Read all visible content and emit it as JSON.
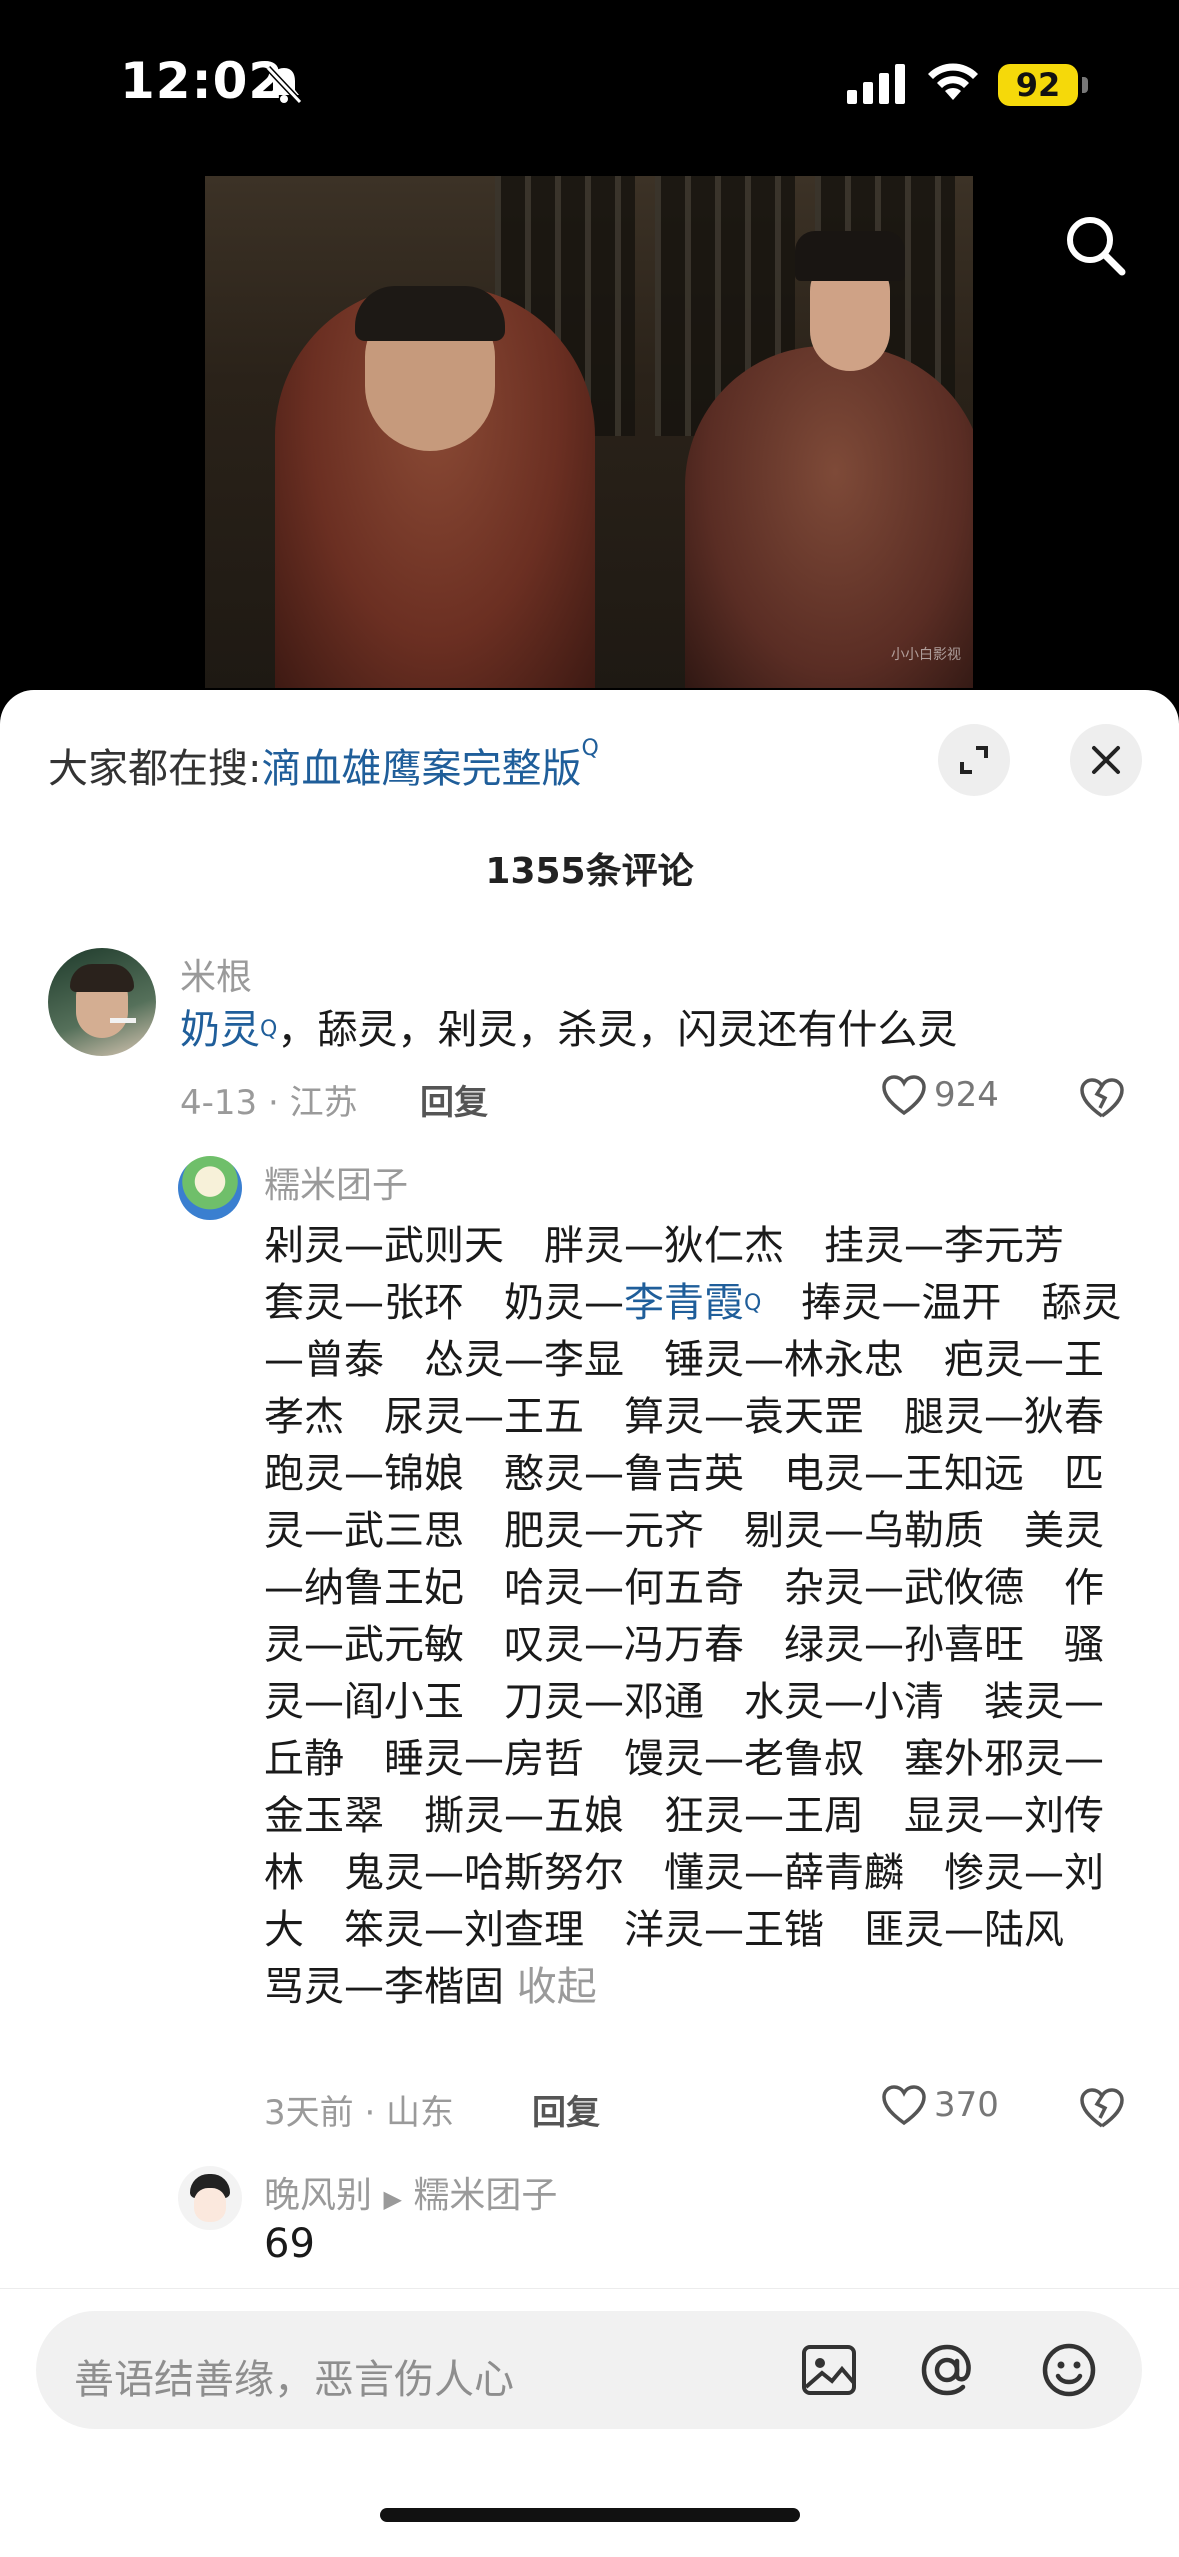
{
  "status_bar": {
    "time": "12:02",
    "battery": "92"
  },
  "video": {
    "watermark": "小小白影视"
  },
  "sheet": {
    "hot_search_prefix": "大家都在搜:",
    "hot_search_keyword": "滴血雄鹰案完整版",
    "comment_count": "1355条评论"
  },
  "comments": [
    {
      "user": "米根",
      "text_link": "奶灵",
      "text_rest": "，舔灵，剁灵，杀灵，闪灵还有什么灵",
      "meta": "4-13 · 江苏",
      "reply_label": "回复",
      "likes": "924"
    },
    {
      "user": "糯米团子",
      "text_part1": "剁灵—武则天　胖灵—狄仁杰　挂灵—李元芳　套灵—张环　奶灵—",
      "text_link": "李青霞",
      "text_part2": "　捧灵—温开　舔灵—曾泰　怂灵—李显　锤灵—林永忠　疤灵—王孝杰　尿灵—王五　算灵—袁天罡　腿灵—狄春　跑灵—锦娘　憨灵—鲁吉英　电灵—王知远　匹灵—武三思　肥灵—元齐　剔灵—乌勒质　美灵—纳鲁王妃　哈灵—何五奇　杂灵—武攸德　作灵—武元敏　叹灵—冯万春　绿灵—孙喜旺　骚灵—阎小玉　刀灵—邓通　水灵—小清　装灵—丘静　睡灵—房哲　馒灵—老鲁叔　塞外邪灵—金玉翠　撕灵—五娘　狂灵—王周　显灵—刘传林　鬼灵—哈斯努尔　懂灵—薛青麟　惨灵—刘大　笨灵—刘查理　洋灵—王锴　匪灵—陆风　骂灵—李楷固",
      "collapse": "收起",
      "meta": "3天前 · 山东",
      "reply_label": "回复",
      "likes": "370"
    },
    {
      "user": "晚风别",
      "reply_to": "糯米团子",
      "text": "69"
    }
  ],
  "input": {
    "placeholder": "善语结善缘，恶言伤人心"
  }
}
